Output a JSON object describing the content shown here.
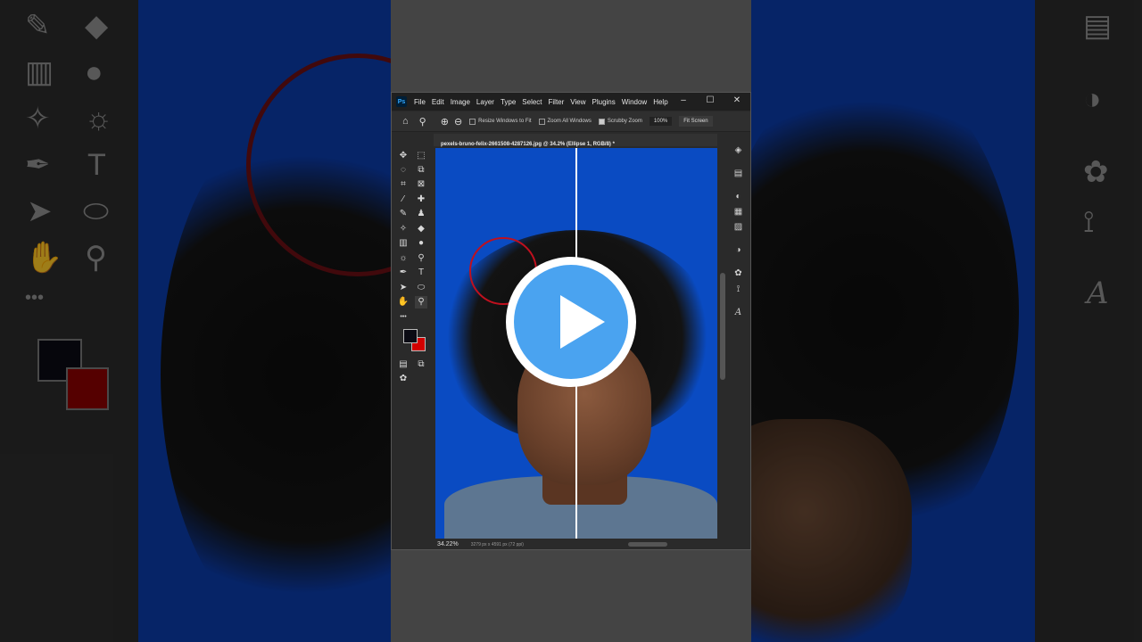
{
  "app": {
    "logo": "Ps"
  },
  "menubar": {
    "items": [
      "File",
      "Edit",
      "Image",
      "Layer",
      "Type",
      "Select",
      "Filter",
      "View",
      "Plugins",
      "Window",
      "Help"
    ],
    "controls": {
      "minimize": "–",
      "maximize": "☐",
      "close": "✕"
    }
  },
  "options_bar": {
    "resize_windows": "Resize Windows to Fit",
    "zoom_all_windows": "Zoom All Windows",
    "scrubby_zoom": "Scrubby Zoom",
    "zoom_value": "100%",
    "fit_screen": "Fit Screen"
  },
  "document_tab": {
    "title": "pexels-bruno-felix-2661508-4287126.jpg @ 34.2% (Ellipse 1, RGB/8) *"
  },
  "status_bar": {
    "zoom": "34.22%",
    "info": "3279 px x 4591 px (72 ppi)"
  },
  "colors": {
    "foreground": "#0b0b14",
    "background": "#d10000",
    "canvas": "#0a4bc2",
    "accent": "#4aa3f0"
  },
  "icons": {
    "home": "⌂",
    "zoom": "⚲",
    "zoom_in": "⊕",
    "zoom_out": "⊖",
    "move": "✥",
    "marquee": "⬚",
    "lasso": "◌",
    "object_select": "⧉",
    "crop": "⌗",
    "frame": "⊠",
    "eyedropper": "⁄",
    "healing": "✚",
    "brush": "✎",
    "stamp": "♟",
    "history": "✧",
    "eraser": "◆",
    "gradient": "▥",
    "blur": "●",
    "dodge": "☼",
    "pen": "✒",
    "type": "T",
    "path_select": "➤",
    "ellipse": "⬭",
    "hand": "✋",
    "zoom_tool": "⚲",
    "more": "•••",
    "layers": "◈",
    "libraries": "▤",
    "adjust": "◐",
    "styles": "▦",
    "gradients_panel": "▨",
    "color_wheel": "◑",
    "channels": "✿",
    "paths": "⟟",
    "glyphs": "A"
  },
  "play_button": {
    "label": "Play video"
  }
}
